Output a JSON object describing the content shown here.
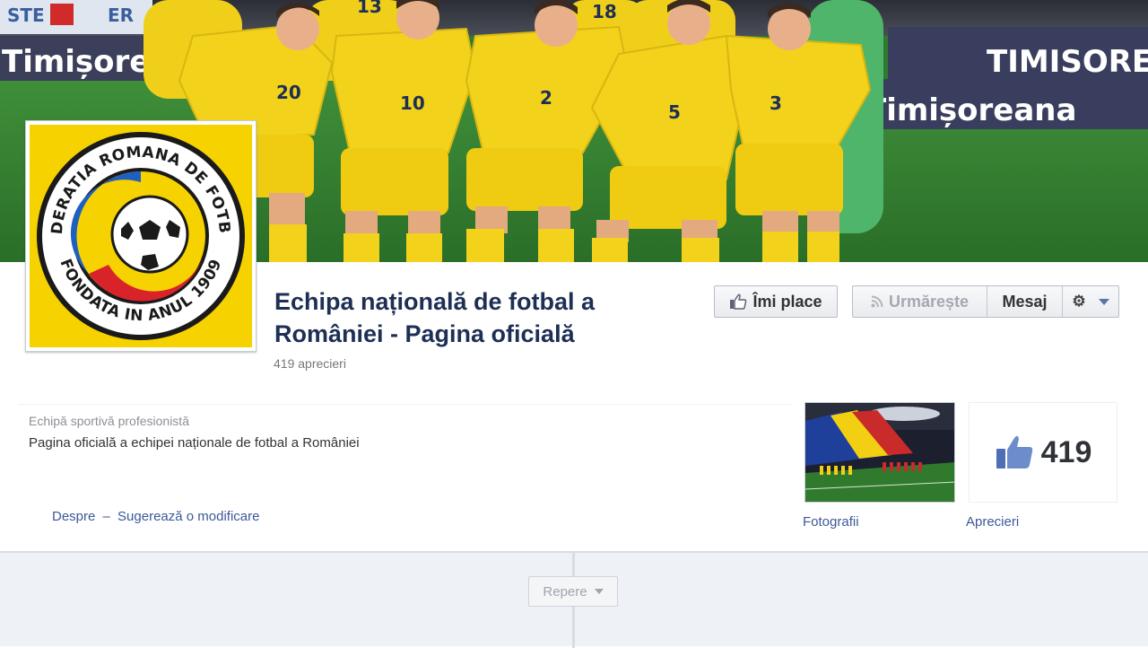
{
  "cover": {
    "ad_left_top": "STE",
    "ad_left_top2": "ER",
    "ad_left_brand": "Timișoreana",
    "ad_right_brand": "TIMISOREA",
    "ad_right_brand2": "Timișoreana",
    "jersey_numbers": [
      "20",
      "10",
      "2",
      "5",
      "3",
      "18",
      "13"
    ]
  },
  "profile": {
    "crest_top_text": "FEDERATIA ROMANA DE FOTBAL",
    "crest_bottom_text": "FONDATA IN ANUL 1909",
    "background_color": "#f6d200"
  },
  "header": {
    "title": "Echipa națională de fotbal a României - Pagina oficială",
    "likes_line": "419 aprecieri"
  },
  "actions": {
    "like_label": "Îmi place",
    "follow_label": "Urmărește",
    "message_label": "Mesaj"
  },
  "about": {
    "category": "Echipă sportivă profesionistă",
    "description": "Pagina oficială a echipei naționale de fotbal a României",
    "link_about": "Despre",
    "separator": "–",
    "link_suggest": "Sugerează o modificare"
  },
  "apps": {
    "photos_label": "Fotografii",
    "likes_count": "419",
    "likes_label": "Aprecieri"
  },
  "timeline": {
    "milestones_label": "Repere"
  },
  "colors": {
    "title": "#1e2f55",
    "link": "#3b5998",
    "jersey": "#f3d21b",
    "pitch": "#2f7a2d"
  }
}
